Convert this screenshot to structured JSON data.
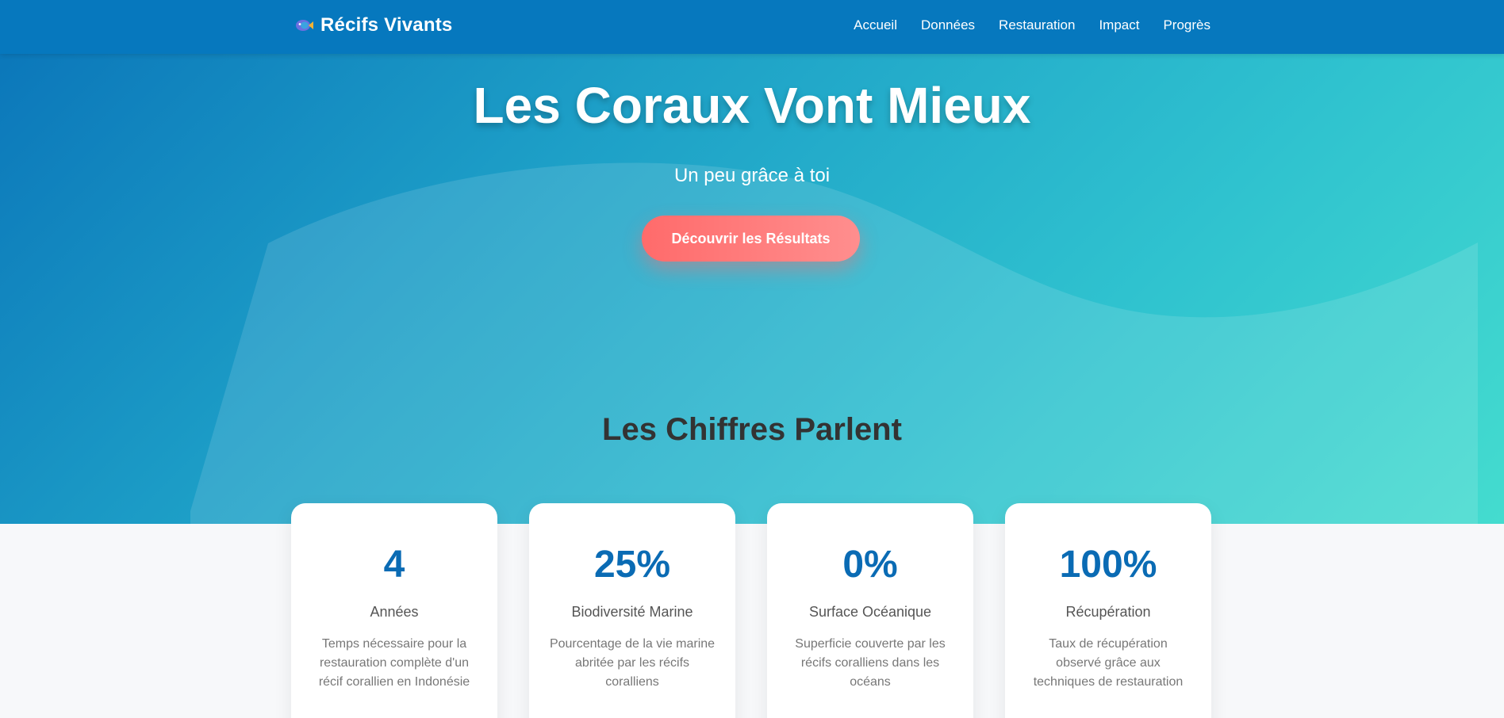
{
  "nav": {
    "brand": "Récifs Vivants",
    "links": [
      "Accueil",
      "Données",
      "Restauration",
      "Impact",
      "Progrès"
    ]
  },
  "hero": {
    "title": "Les Coraux Vont Mieux",
    "subtitle": "Un peu grâce à toi",
    "cta_label": "Découvrir les Résultats"
  },
  "stats": {
    "title": "Les Chiffres Parlent",
    "cards": [
      {
        "value": "4",
        "label": "Années",
        "description": "Temps nécessaire pour la restauration complète d'un récif corallien en Indonésie"
      },
      {
        "value": "25%",
        "label": "Biodiversité Marine",
        "description": "Pourcentage de la vie marine abritée par les récifs coralliens"
      },
      {
        "value": "0%",
        "label": "Surface Océanique",
        "description": "Superficie couverte par les récifs coralliens dans les océans"
      },
      {
        "value": "100%",
        "label": "Récupération",
        "description": "Taux de récupération observé grâce aux techniques de restauration"
      }
    ]
  },
  "colors": {
    "nav_bg": "#0678be",
    "accent_value": "#0a6bb4",
    "cta": "#ff6b6b"
  }
}
